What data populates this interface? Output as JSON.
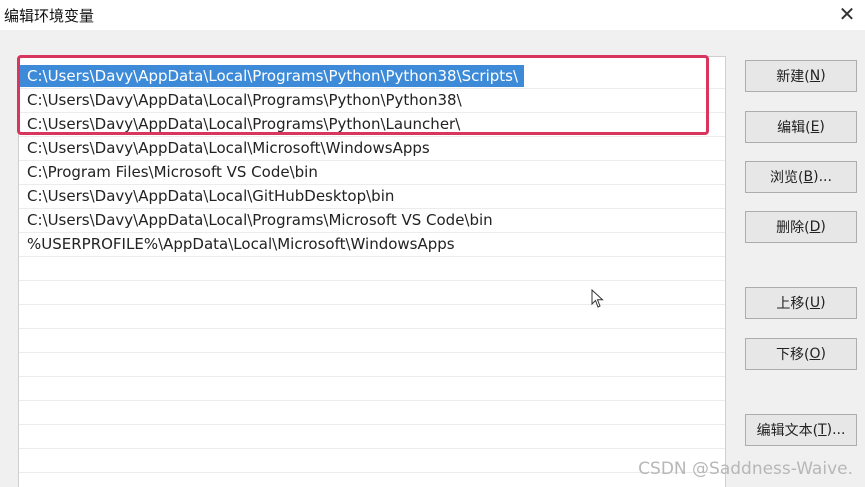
{
  "window": {
    "title": "编辑环境变量",
    "close_glyph": "✕"
  },
  "list": {
    "items": [
      "C:\\Users\\Davy\\AppData\\Local\\Programs\\Python\\Python38\\Scripts\\",
      "C:\\Users\\Davy\\AppData\\Local\\Programs\\Python\\Python38\\",
      "C:\\Users\\Davy\\AppData\\Local\\Programs\\Python\\Launcher\\",
      "C:\\Users\\Davy\\AppData\\Local\\Microsoft\\WindowsApps",
      "C:\\Program Files\\Microsoft VS Code\\bin",
      "C:\\Users\\Davy\\AppData\\Local\\GitHubDesktop\\bin",
      "C:\\Users\\Davy\\AppData\\Local\\Programs\\Microsoft VS Code\\bin",
      "%USERPROFILE%\\AppData\\Local\\Microsoft\\WindowsApps"
    ],
    "selected_index": 0,
    "highlight_color": "#d9365e"
  },
  "buttons": {
    "new": {
      "label": "新建(",
      "key": "N",
      "suffix": ")"
    },
    "edit": {
      "label": "编辑(",
      "key": "E",
      "suffix": ")"
    },
    "browse": {
      "label": "浏览(",
      "key": "B",
      "suffix": ")..."
    },
    "delete": {
      "label": "删除(",
      "key": "D",
      "suffix": ")"
    },
    "move_up": {
      "label": "上移(",
      "key": "U",
      "suffix": ")"
    },
    "move_down": {
      "label": "下移(",
      "key": "O",
      "suffix": ")"
    },
    "edit_text": {
      "label": "编辑文本(",
      "key": "T",
      "suffix": ")..."
    }
  },
  "watermark": "CSDN @Saddness-Waive.",
  "icons": {
    "cursor": "mouse-pointer-icon"
  }
}
